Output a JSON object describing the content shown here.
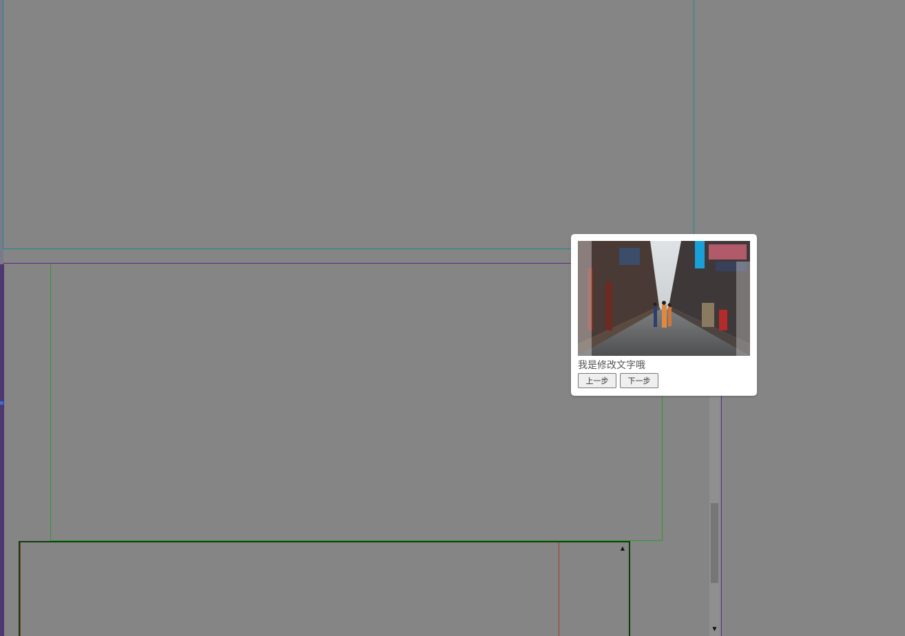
{
  "popup": {
    "image_alt": "Ancient street scene",
    "caption": "我是修改文字哦",
    "buttons": {
      "prev_label": "上一步",
      "next_label": "下一步"
    }
  },
  "colors": {
    "background": "#858585",
    "teal_outline": "#1d8a8a",
    "purple_outline": "#5b2a86",
    "green_outline": "#2a9a2a",
    "dark_green_outline": "#0f3a0f",
    "red_line": "#a33a2a",
    "popup_bg": "#ffffff"
  },
  "icons": {
    "scroll_up": "triangle-up-icon",
    "scroll_down": "triangle-down-icon"
  }
}
